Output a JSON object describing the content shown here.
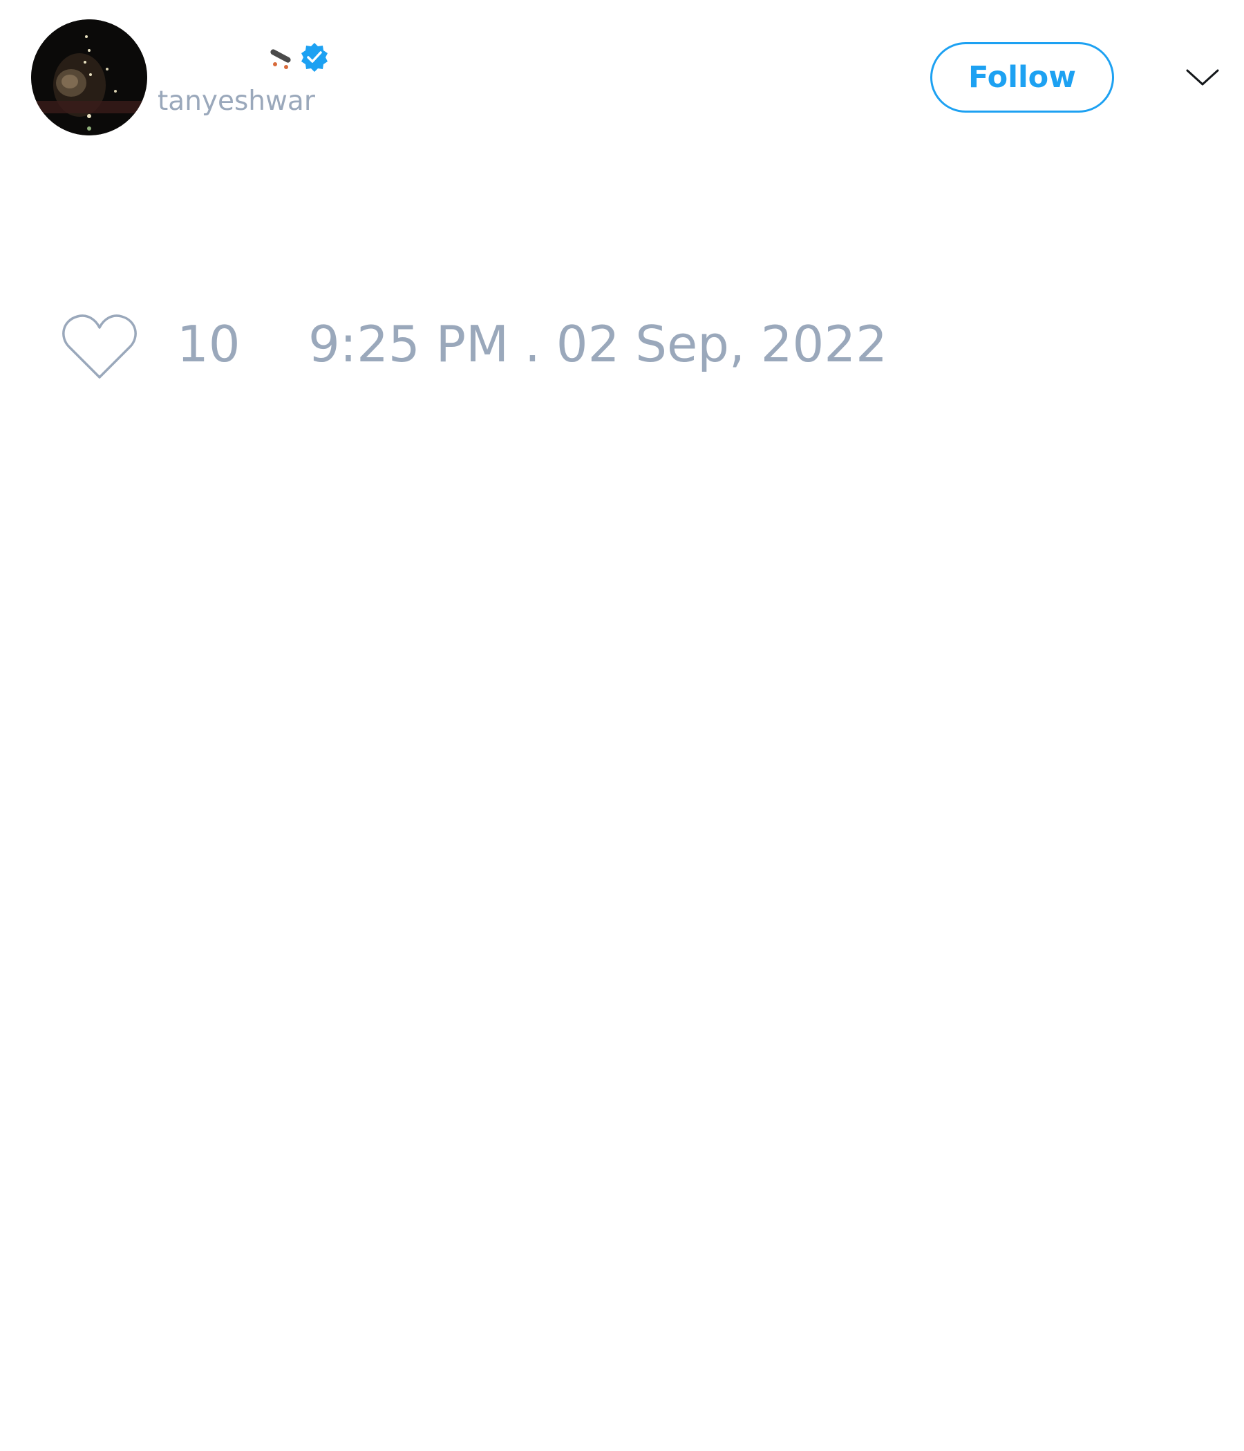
{
  "author": {
    "display_name": "",
    "handle": "tanyeshwar",
    "name_emoji_icon": "skateboard-icon",
    "verified_icon": "verified-badge-icon"
  },
  "header": {
    "follow_label": "Follow",
    "menu_icon": "chevron-down-icon"
  },
  "footer": {
    "like_icon": "heart-icon",
    "like_count": "10",
    "timestamp": "9:25 PM . 02 Sep, 2022"
  },
  "colors": {
    "accent": "#1da1f2",
    "muted_text": "#9aa8bb",
    "background": "#ffffff"
  }
}
